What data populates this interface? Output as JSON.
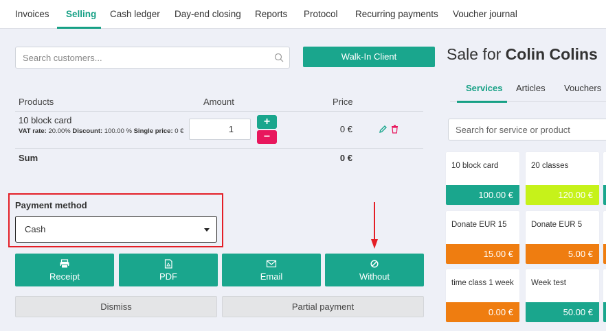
{
  "nav": {
    "tabs": [
      {
        "label": "Invoices"
      },
      {
        "label": "Selling"
      },
      {
        "label": "Cash ledger"
      },
      {
        "label": "Day-end closing"
      },
      {
        "label": "Reports"
      },
      {
        "label": "Protocol"
      },
      {
        "label": "Recurring payments"
      },
      {
        "label": "Voucher journal"
      }
    ],
    "active": "Selling"
  },
  "customer_search": {
    "placeholder": "Search customers..."
  },
  "walkin_label": "Walk-In Client",
  "table": {
    "headers": {
      "products": "Products",
      "amount": "Amount",
      "price": "Price"
    },
    "row": {
      "name": "10 block card",
      "vat_label": "VAT rate:",
      "vat_value": "20.00%",
      "discount_label": "Discount:",
      "discount_value": "100.00 %",
      "single_label": "Single price:",
      "single_value": "0 €",
      "amount": "1",
      "price": "0 €"
    },
    "sum_label": "Sum",
    "sum_value": "0 €"
  },
  "payment": {
    "label": "Payment method",
    "selected": "Cash"
  },
  "actions": [
    {
      "label": "Receipt",
      "icon": "printer-icon"
    },
    {
      "label": "PDF",
      "icon": "pdf-icon"
    },
    {
      "label": "Email",
      "icon": "envelope-icon"
    },
    {
      "label": "Without",
      "icon": "ban-icon"
    }
  ],
  "secondary": {
    "dismiss": "Dismiss",
    "partial": "Partial payment"
  },
  "sale": {
    "prefix": "Sale for",
    "customer": "Colin Colins"
  },
  "right_tabs": [
    {
      "label": "Services"
    },
    {
      "label": "Articles"
    },
    {
      "label": "Vouchers"
    }
  ],
  "service_search": {
    "placeholder": "Search for service or product"
  },
  "cards": [
    {
      "name": "10 block card",
      "price": "100.00 €",
      "color": "#1aa68d"
    },
    {
      "name": "20 classes",
      "price": "120.00 €",
      "color": "#c6f21a"
    },
    {
      "name": "Donate EUR 15",
      "price": "15.00 €",
      "color": "#ef7d10"
    },
    {
      "name": "Donate EUR 5",
      "price": "5.00 €",
      "color": "#ef7d10"
    },
    {
      "name": "time class 1 week",
      "price": "0.00 €",
      "color": "#ef7d10"
    },
    {
      "name": "Week test",
      "price": "50.00 €",
      "color": "#1aa68d"
    }
  ],
  "side_card_colors": [
    "#1aa68d",
    "#ef7d10",
    "#1aa68d"
  ],
  "colors": {
    "accent": "#1aa68d",
    "danger": "#e8175d",
    "highlight": "#e41e26"
  }
}
